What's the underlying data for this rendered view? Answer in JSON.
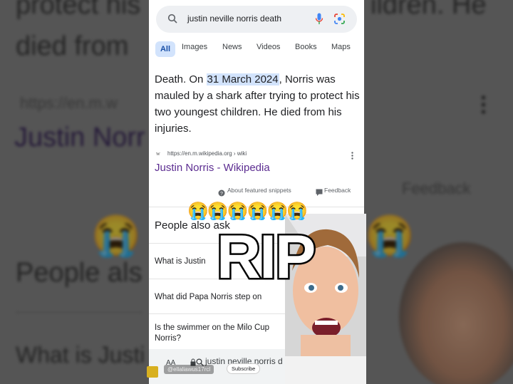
{
  "background": {
    "top_left_line1": "protect his",
    "top_left_line2": "died from",
    "top_right_line1": "ildren. He",
    "url_text": "https://en.m.w",
    "link_text": "Justin Norr",
    "feedback_text": "Feedback",
    "people_text": "People als",
    "what_text": "What is Justi"
  },
  "search": {
    "query": "justin neville norris death"
  },
  "tabs": {
    "all": "All",
    "images": "Images",
    "news": "News",
    "videos": "Videos",
    "books": "Books",
    "maps": "Maps"
  },
  "snippet": {
    "pre": "Death. On ",
    "date": "31 March 2024",
    "post": ", Norris was mauled by a shark after trying to protect his two youngest children. He died from his injuries."
  },
  "source": {
    "url": "https://en.m.wikipedia.org › wiki",
    "title": "Justin Norris - Wikipedia"
  },
  "snippet_footer": {
    "about": "About featured snippets",
    "feedback": "Feedback"
  },
  "paa": {
    "heading": "People also ask",
    "questions": [
      "What is Justin",
      "What did Papa Norris step on",
      "Is the swimmer on the Milo Cup",
      "Norris?"
    ]
  },
  "bottom": {
    "aa": "AA",
    "address": "justin neville norris d",
    "handle": "@ellaliawus17rcl",
    "subscribe": "Subscribe"
  },
  "overlay": {
    "emojis": "😭😭😭😭😭😭",
    "rip": "RIP"
  },
  "colors": {
    "accent_blue": "#1a73e8",
    "link_purple": "#5c2d91",
    "highlight": "#d2e3fc"
  }
}
